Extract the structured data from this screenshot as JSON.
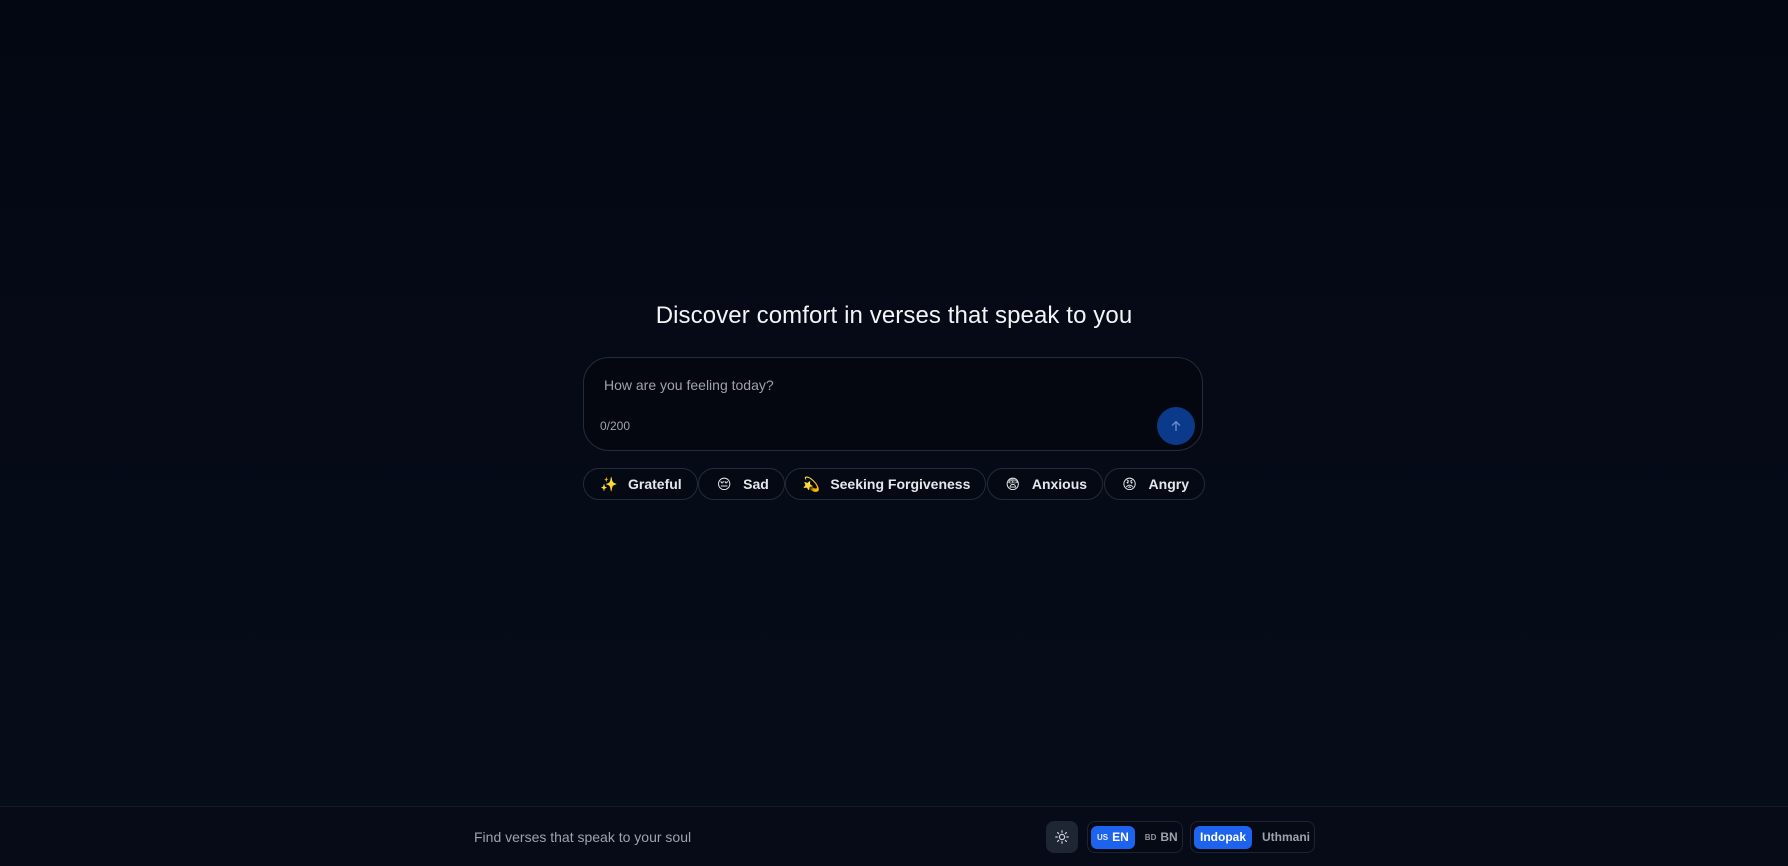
{
  "hero": {
    "title": "Discover comfort in verses that speak to you"
  },
  "query": {
    "placeholder": "How are you feeling today?",
    "value": "",
    "char_count": "0/200",
    "send_icon": "arrow-up-icon"
  },
  "moods": [
    {
      "emoji": "✨",
      "label": "Grateful",
      "icon": "sparkles-icon"
    },
    {
      "emoji": "😔",
      "label": "Sad",
      "icon": "pensive-face-icon"
    },
    {
      "emoji": "💫",
      "label": "Seeking Forgiveness",
      "icon": "dizzy-icon"
    },
    {
      "emoji": "😨",
      "label": "Anxious",
      "icon": "fearful-face-icon"
    },
    {
      "emoji": "😡",
      "label": "Angry",
      "icon": "angry-face-icon"
    }
  ],
  "footer": {
    "tagline": "Find verses that speak to your soul",
    "theme_icon": "sun-icon",
    "language": {
      "options": [
        {
          "flag": "US",
          "label": "EN",
          "active": true
        },
        {
          "flag": "BD",
          "label": "BN",
          "active": false
        }
      ]
    },
    "script": {
      "options": [
        {
          "label": "Indopak",
          "active": true
        },
        {
          "label": "Uthmani",
          "active": false
        }
      ]
    }
  },
  "colors": {
    "background": "#030712",
    "accent": "#1d63ed",
    "send_button": "#0b3a8a",
    "border": "#242b3a"
  }
}
